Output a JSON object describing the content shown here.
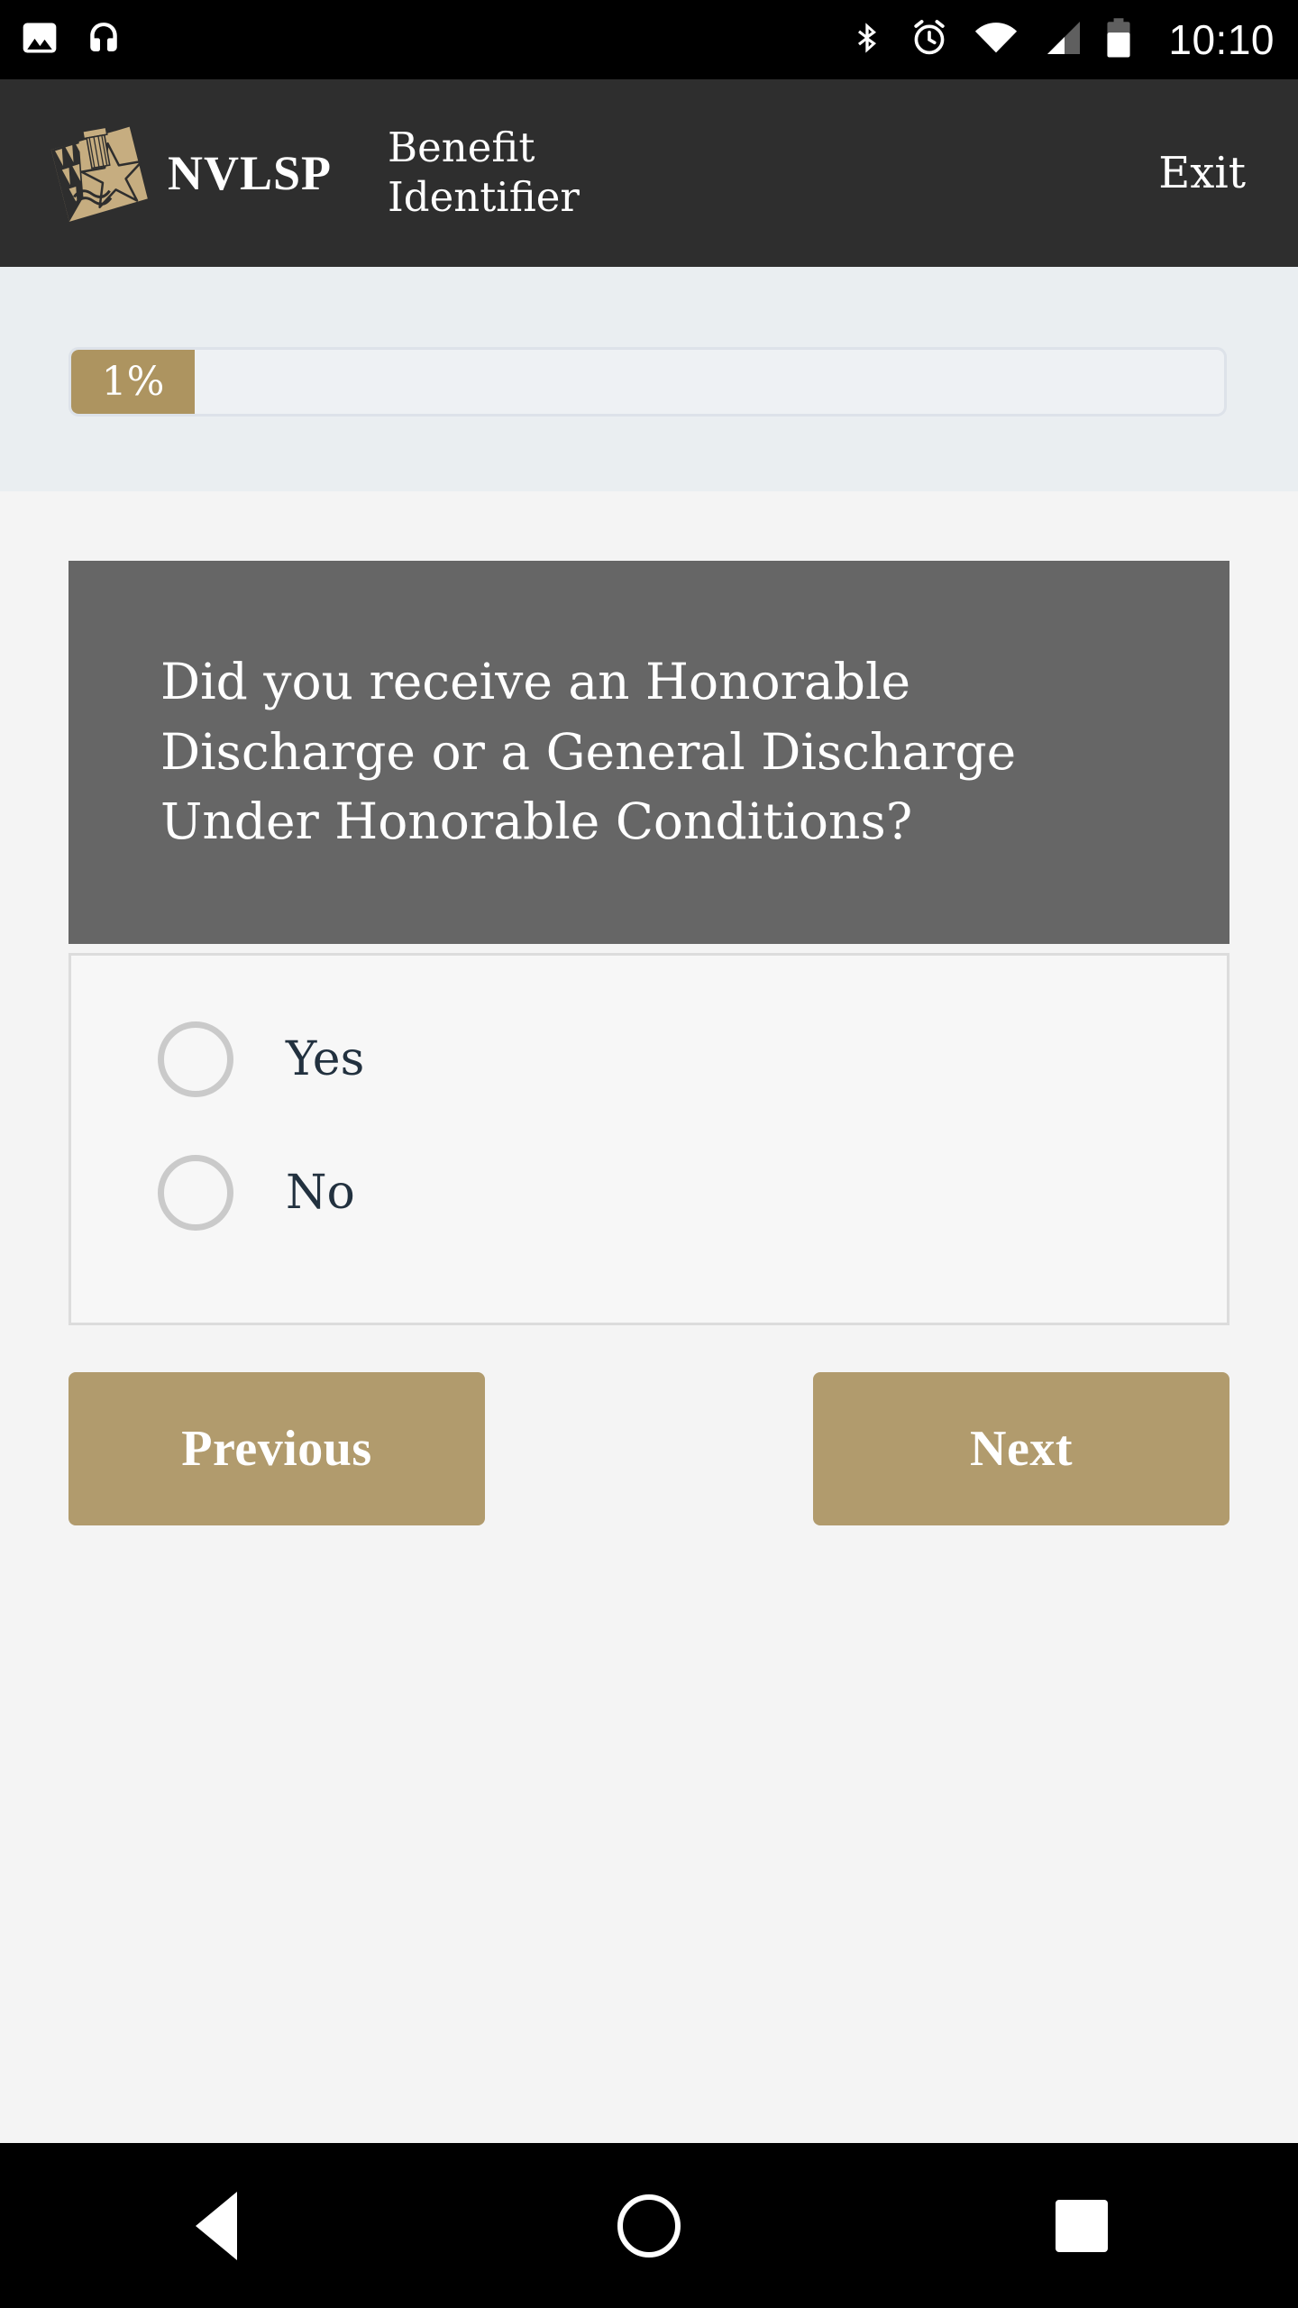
{
  "status_bar": {
    "left_icons": [
      {
        "name": "photo-icon",
        "label": "Screenshot"
      },
      {
        "name": "headphones-icon",
        "label": "Headphones"
      }
    ],
    "right_icons": [
      {
        "name": "bluetooth-icon",
        "label": "Bluetooth"
      },
      {
        "name": "alarm-clock-icon",
        "label": "Alarm"
      },
      {
        "name": "wifi-icon",
        "label": "Wi-Fi"
      },
      {
        "name": "cellular-signal-icon",
        "label": "Signal"
      },
      {
        "name": "battery-icon",
        "label": "Battery"
      }
    ],
    "time": "10:10"
  },
  "app_bar": {
    "logo_name": "nvlsp-logo",
    "brand": "NVLSP",
    "title": "Benefit Identifier",
    "exit_label": "Exit",
    "background_color": "#2e2e2e"
  },
  "progress": {
    "percent_label": "1%",
    "percent_value": 1,
    "fill_color": "#ad9460",
    "track_color": "#eef1f4",
    "section_background": "#eaeef1"
  },
  "question": {
    "text": "Did you receive an Honorable Discharge or a General Discharge Under Honorable Conditions?",
    "header_background": "#666666"
  },
  "answers": {
    "options": [
      {
        "label": "Yes",
        "selected": false
      },
      {
        "label": "No",
        "selected": false
      }
    ],
    "card_background": "#f7f7f7",
    "border_color": "#dcdcdc",
    "label_color": "#22313f"
  },
  "navigation": {
    "previous_label": "Previous",
    "next_label": "Next",
    "button_color": "#b19b6d"
  },
  "system_nav": {
    "back_label": "Back",
    "home_label": "Home",
    "recents_label": "Recent apps"
  }
}
